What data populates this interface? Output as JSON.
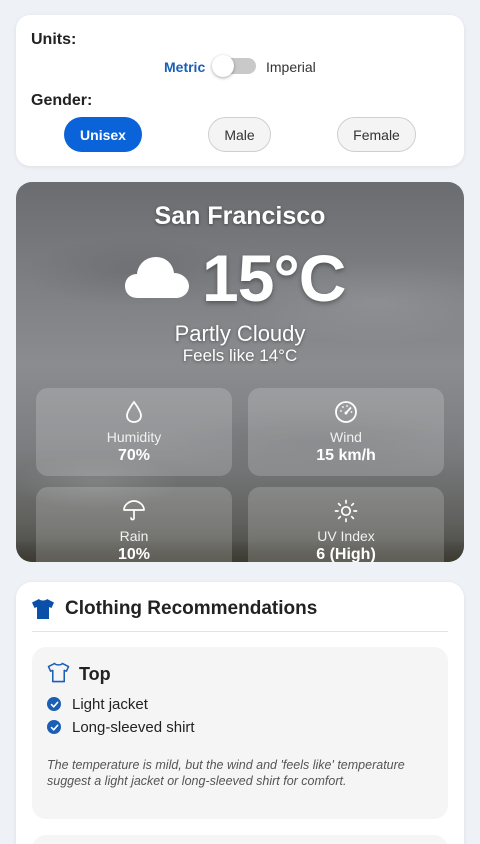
{
  "settings": {
    "units_label": "Units:",
    "metric_label": "Metric",
    "imperial_label": "Imperial",
    "metric_selected": true,
    "gender_label": "Gender:",
    "gender_options": [
      "Unisex",
      "Male",
      "Female"
    ],
    "gender_selected": "Unisex"
  },
  "weather": {
    "city": "San Francisco",
    "temperature": "15°C",
    "condition": "Partly Cloudy",
    "feels_like": "Feels like 14°C",
    "icon": "cloud-icon",
    "stats": [
      {
        "label": "Humidity",
        "value": "70%",
        "icon": "droplet-icon"
      },
      {
        "label": "Wind",
        "value": "15 km/h",
        "icon": "gauge-icon"
      },
      {
        "label": "Rain",
        "value": "10%",
        "icon": "umbrella-icon"
      },
      {
        "label": "UV Index",
        "value": "6 (High)",
        "icon": "sun-icon"
      }
    ]
  },
  "clothing": {
    "title": "Clothing Recommendations",
    "sections": [
      {
        "title": "Top",
        "items": [
          "Light jacket",
          "Long-sleeved shirt"
        ],
        "note": "The temperature is mild, but the wind and 'feels like' temperature suggest a light jacket or long-sleeved shirt for comfort."
      }
    ]
  },
  "colors": {
    "accent": "#0a63d8",
    "metric_text": "#1a5fb4",
    "page_bg": "#eef1f6"
  }
}
